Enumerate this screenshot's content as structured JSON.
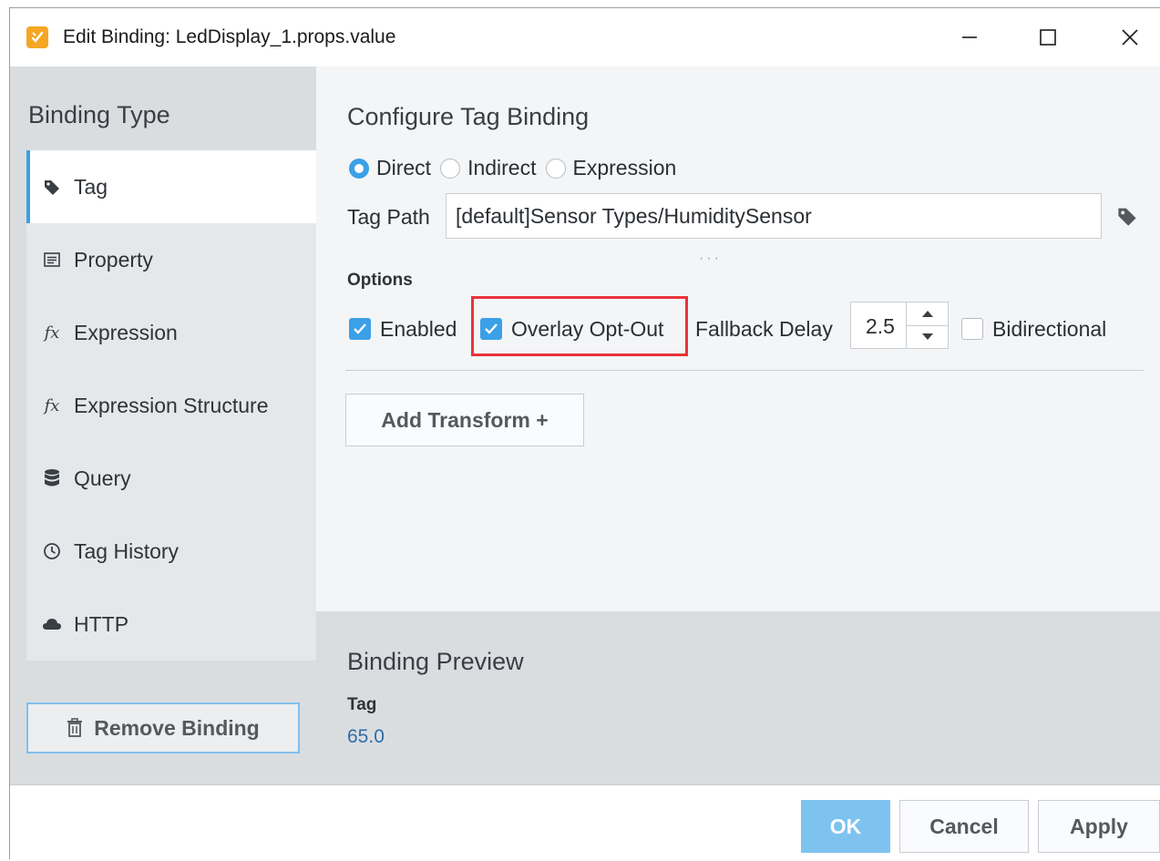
{
  "window": {
    "title": "Edit Binding: LedDisplay_1.props.value"
  },
  "sidebar": {
    "title": "Binding Type",
    "items": [
      {
        "label": "Tag",
        "icon": "tag-icon",
        "active": true
      },
      {
        "label": "Property",
        "icon": "property-icon"
      },
      {
        "label": "Expression",
        "icon": "fx-icon"
      },
      {
        "label": "Expression Structure",
        "icon": "fx-icon"
      },
      {
        "label": "Query",
        "icon": "database-icon"
      },
      {
        "label": "Tag History",
        "icon": "clock-icon"
      },
      {
        "label": "HTTP",
        "icon": "cloud-icon"
      }
    ],
    "remove_label": "Remove Binding",
    "fx_glyph": "fx"
  },
  "config": {
    "title": "Configure Tag Binding",
    "radio": {
      "direct": "Direct",
      "indirect": "Indirect",
      "expression": "Expression",
      "selected": "Direct"
    },
    "tag_path_label": "Tag Path",
    "tag_path_value": "[default]Sensor Types/HumiditySensor",
    "options_label": "Options",
    "enabled_label": "Enabled",
    "enabled_checked": true,
    "overlay_label": "Overlay Opt-Out",
    "overlay_checked": true,
    "fallback_label": "Fallback Delay",
    "fallback_value": "2.5",
    "bidirectional_label": "Bidirectional",
    "bidirectional_checked": false,
    "add_transform_label": "Add Transform +"
  },
  "preview": {
    "title": "Binding Preview",
    "tag_label": "Tag",
    "value": "65.0"
  },
  "footer": {
    "ok": "OK",
    "cancel": "Cancel",
    "apply": "Apply"
  },
  "colors": {
    "accent": "#3ba0e6",
    "highlight": "#e8333b",
    "app_icon": "#f5a623",
    "preview_value": "#2c6ea8"
  }
}
